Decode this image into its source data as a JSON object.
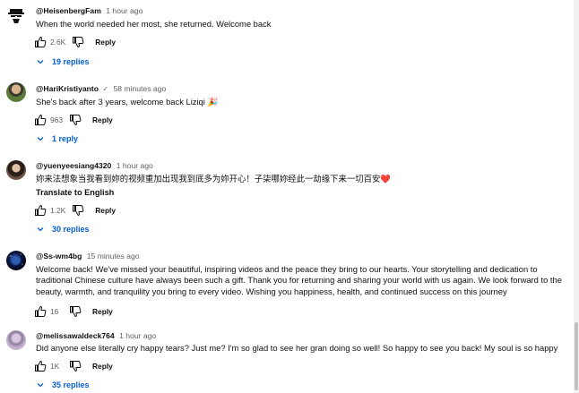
{
  "comments": [
    {
      "author": "@HeisenbergFam",
      "time": "1 hour ago",
      "text": "When the world needed her most, she returned. Welcome back",
      "likes": "2.6K",
      "reply_label": "Reply",
      "replies_label": "19 replies",
      "avatar_icon": "heisenberg-hat-avatar"
    },
    {
      "author": "@HariKristiyanto",
      "verified_icon": "check-icon",
      "time": "58 minutes ago",
      "text": "She's back after 3 years, welcome back Liziqi 🎉",
      "likes": "963",
      "reply_label": "Reply",
      "replies_label": "1 reply",
      "avatar_icon": "user-photo-avatar"
    },
    {
      "author": "@yuenyeesiang4320",
      "time": "1 hour ago",
      "text": "妳来法想象当我看到妳的视频重加出现我到底多为妳开心！子柒哪妳经此一劫缘下来一切百安❤️",
      "translate_label": "Translate to English",
      "likes": "1.2K",
      "reply_label": "Reply",
      "replies_label": "30 replies",
      "avatar_icon": "user-photo-avatar"
    },
    {
      "author": "@Ss-wm4bg",
      "time": "15 minutes ago",
      "text": "Welcome back! We've missed your beautiful, inspiring videos and the peace they bring to our hearts. Your storytelling and dedication to traditional Chinese culture have always been such a gift. Thank you for returning and sharing your world with us again. We look forward to the beauty, warmth, and tranquility you bring to every video. Wishing you happiness, health, and continued success on this journey",
      "likes": "16",
      "reply_label": "Reply",
      "avatar_icon": "planet-avatar"
    },
    {
      "author": "@melissawaldeck764",
      "time": "1 hour ago",
      "text": "Did anyone else literally cry happy tears? Just me? I'm so glad to see her gran doing so well! So happy to see you back! My soul is so happy",
      "likes": "1K",
      "reply_label": "Reply",
      "replies_label": "35 replies",
      "avatar_icon": "user-photo-avatar"
    }
  ],
  "colors": {
    "link_blue": "#065fd4",
    "meta_gray": "#606060",
    "text": "#0f0f0f",
    "heart_red": "#e0245e"
  }
}
